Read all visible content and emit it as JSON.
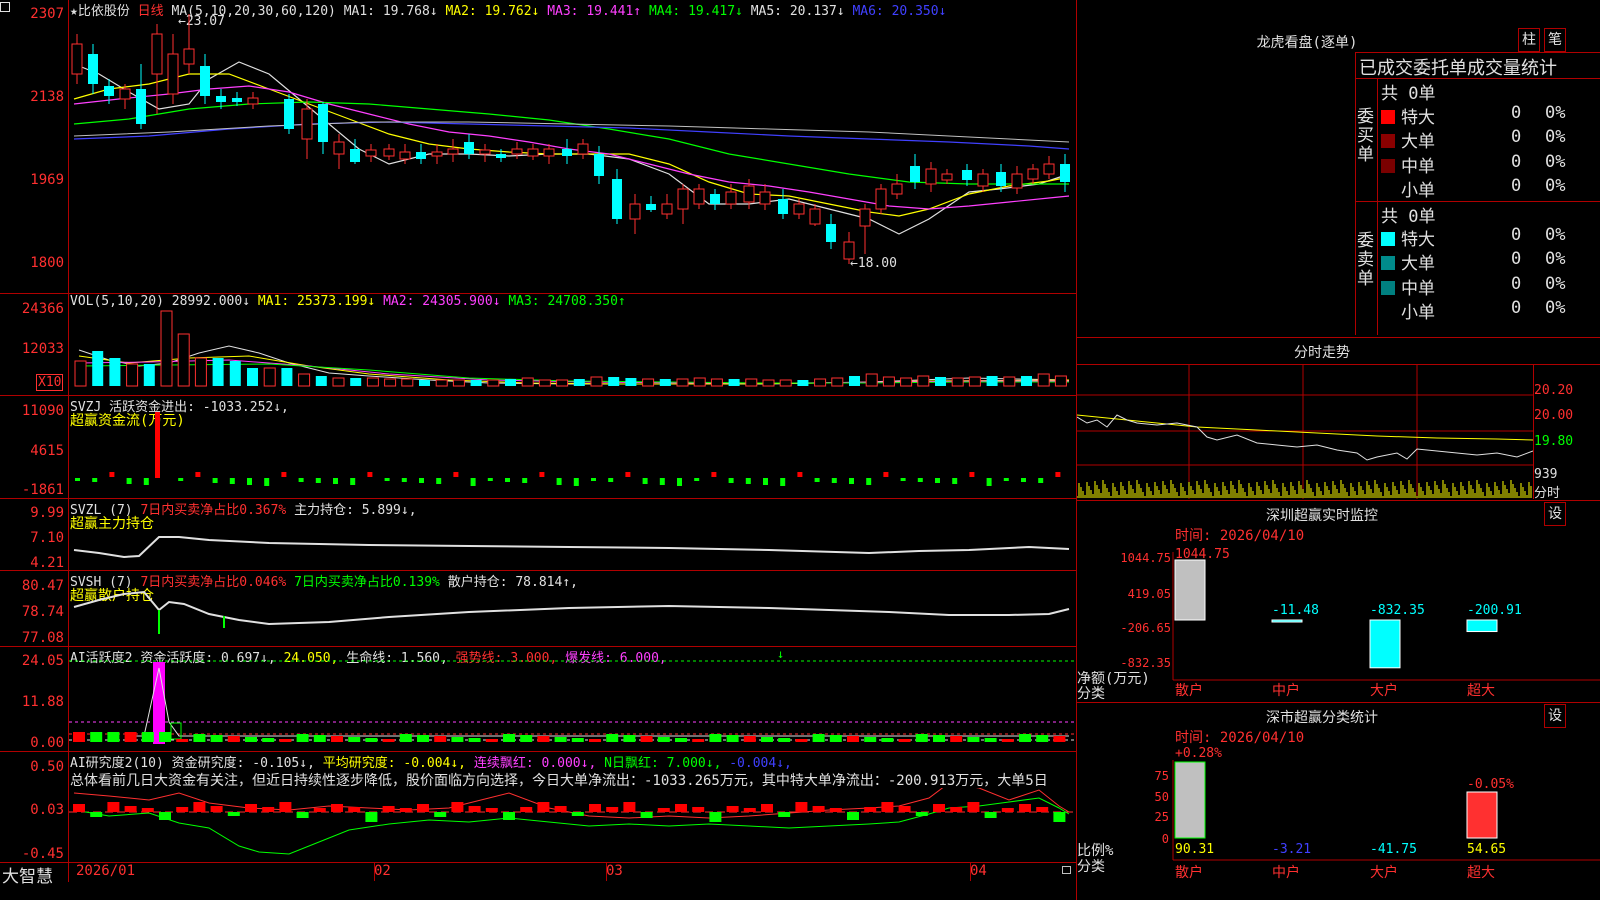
{
  "stock": {
    "title": "★比依股份",
    "period": "日线"
  },
  "main": {
    "ma_label": "MA(5,10,20,30,60,120)",
    "ma1": "MA1: 19.768↓",
    "ma2": "MA2: 19.762↓",
    "ma3": "MA3: 19.441↑",
    "ma4": "MA4: 19.417↓",
    "ma5": "MA5: 20.137↓",
    "ma6": "MA6: 20.350↓",
    "yticks": [
      "2307",
      "2138",
      "1969",
      "1800"
    ],
    "high_label": "←23.07",
    "low_label": "←18.00"
  },
  "vol": {
    "label": "VOL(5,10,20)",
    "v": "28992.000↓",
    "ma1": "MA1: 25373.199↓",
    "ma2": "MA2: 24305.900↓",
    "ma3": "MA3: 24708.350↑",
    "yticks": [
      "24366",
      "12033"
    ],
    "unit": "X10"
  },
  "svzj": {
    "label": "SVZJ  活跃资金进出: -1033.252↓,",
    "sub": "超赢资金流(万元)",
    "yticks": [
      "11090",
      "4615",
      "-1861"
    ]
  },
  "svzl": {
    "label_a": "SVZL (7)",
    "label_b": "7日内买卖净占比0.367%",
    "label_c": "主力持仓: 5.899↓,",
    "sub": "超赢主力持仓",
    "yticks": [
      "9.99",
      "7.10",
      "4.21"
    ]
  },
  "svsh": {
    "label_a": "SVSH (7)",
    "label_b": "7日内买卖净占比0.046%",
    "label_c": "7日内买卖净占比0.139%",
    "label_d": "散户持仓: 78.814↑,",
    "sub": "超赢散户持仓",
    "yticks": [
      "80.47",
      "78.74",
      "77.08"
    ]
  },
  "ai1": {
    "label_a": "AI活跃度2",
    "label_b": "资金活跃度: 0.697↓,",
    "label_c": "24.050,",
    "label_d": "生命线: 1.560,",
    "label_e": "强势线: 3.000,",
    "label_f": "爆发线: 6.000,",
    "yticks": [
      "24.05",
      "11.88",
      "0.00"
    ]
  },
  "ai2": {
    "label_a": "AI研究度2(10)",
    "label_b": "资金研究度: -0.105↓,",
    "label_c": "平均研究度: -0.004↓,",
    "label_d": "连续飘红: 0.000↓,",
    "label_e": "N日飘红: 7.000↓,",
    "label_f": "-0.004↓,",
    "comment": "总体看前几日大资金有关注，但近日持续性逐步降低，股价面临方向选择，今日大单净流出：-1033.265万元，其中特大单净流出：-200.913万元，大单5日",
    "yticks": [
      "0.50",
      "0.03",
      "-0.45"
    ]
  },
  "xaxis": {
    "brand": "大智慧",
    "dates": [
      "2026/01",
      "02",
      "03",
      "04"
    ]
  },
  "lhb": {
    "title": "龙虎看盘(逐单)",
    "btn_zhu": "柱",
    "btn_bi": "笔",
    "stats_title": "已成交委托单成交量统计",
    "buy_side": "委买单",
    "sell_side": "委卖单",
    "buy_total": "共 0单",
    "sell_total": "共 0单",
    "buy_rows": [
      {
        "name": "特大",
        "vol": "0",
        "pct": "0%",
        "color": "#ff0000"
      },
      {
        "name": "大单",
        "vol": "0",
        "pct": "0%",
        "color": "#8b0000"
      },
      {
        "name": "中单",
        "vol": "0",
        "pct": "0%",
        "color": "#7a0000"
      },
      {
        "name": "小单",
        "vol": "0",
        "pct": "0%",
        "color": ""
      }
    ],
    "sell_rows": [
      {
        "name": "特大",
        "vol": "0",
        "pct": "0%",
        "color": "#00ffff"
      },
      {
        "name": "大单",
        "vol": "0",
        "pct": "0%",
        "color": "#008b8b"
      },
      {
        "name": "中单",
        "vol": "0",
        "pct": "0%",
        "color": "#008080"
      },
      {
        "name": "小单",
        "vol": "0",
        "pct": "0%",
        "color": ""
      }
    ]
  },
  "fenshi": {
    "title": "分时走势",
    "prices": [
      "20.20",
      "20.00",
      "19.80"
    ],
    "vol_top": "939",
    "vol_unit": "分时"
  },
  "monitor": {
    "title": "深圳超赢实时监控",
    "btn": "设",
    "time": "时间: 2026/04/10",
    "yticks": [
      "1044.75",
      "419.05",
      "-206.65",
      "-832.35"
    ],
    "ylabel_a": "净额(万元)",
    "ylabel_b": "分类",
    "cats": [
      "散户",
      "中户",
      "大户",
      "超大"
    ],
    "values": [
      1044.75,
      -11.48,
      -832.35,
      -200.91
    ],
    "value_labels": [
      "1044.75",
      "-11.48",
      "-832.35",
      "-200.91"
    ]
  },
  "classify": {
    "title": "深市超赢分类统计",
    "btn": "设",
    "time": "时间: 2026/04/10",
    "yticks": [
      "75",
      "50",
      "25",
      "0"
    ],
    "ylabel_a": "比例%",
    "ylabel_b": "分类",
    "top_labels": [
      "+0.28%",
      "-0.05%"
    ],
    "cats": [
      "散户",
      "中户",
      "大户",
      "超大"
    ],
    "values": [
      90.31,
      -3.21,
      -41.75,
      54.65
    ],
    "value_labels": [
      "90.31",
      "-3.21",
      "-41.75",
      "54.65"
    ]
  },
  "colors": {
    "grid": "#b00000",
    "up": "#ff3030",
    "down": "#00ffff",
    "bg": "#000000"
  }
}
